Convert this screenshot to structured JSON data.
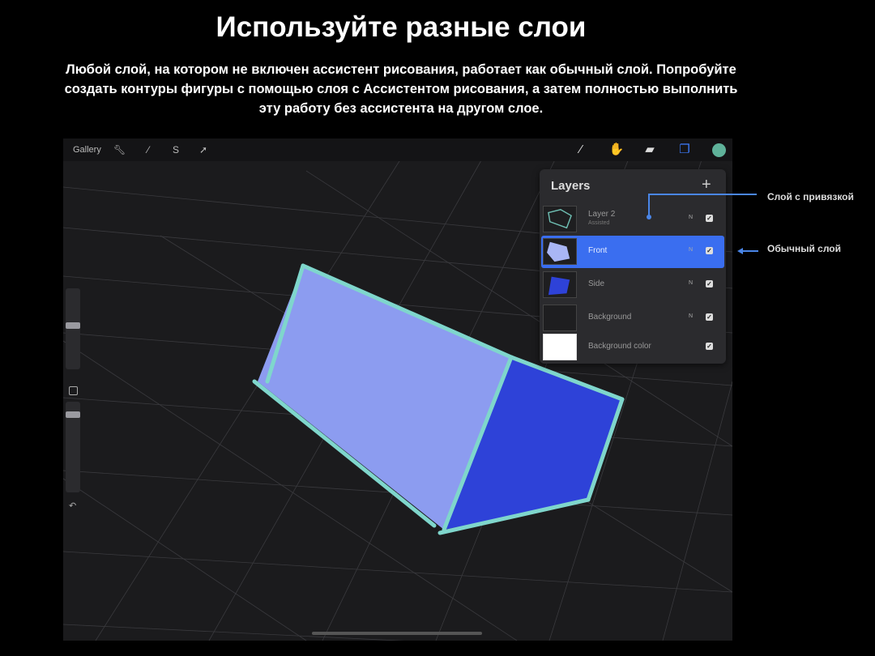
{
  "slide": {
    "title": "Используйте разные слои",
    "description_lines": [
      "Любой слой, на котором не включен ассистент рисования, работает как обычный слой. Попробуйте",
      "создать контуры фигуры с помощью слоя с Ассистентом рисования, а затем полностью выполнить",
      "эту работу без ассистента на другом слое."
    ]
  },
  "app": {
    "toolbar": {
      "gallery_label": "Gallery",
      "left_icons": [
        "wrench-icon",
        "magic-wand-icon",
        "selection-s-icon",
        "transform-arrow-icon"
      ],
      "right_icons": [
        "brush-icon",
        "smudge-icon",
        "eraser-icon",
        "layers-icon"
      ],
      "accent_color": "#3d7dff",
      "current_color": "#5fb29a"
    },
    "layers_panel": {
      "title": "Layers",
      "add_icon": "+",
      "layers": [
        {
          "name": "Layer 2",
          "sub": "Assisted",
          "mode": "N",
          "visible": true,
          "active": false,
          "thumb": "outline"
        },
        {
          "name": "Front",
          "sub": "",
          "mode": "N",
          "visible": true,
          "active": true,
          "thumb": "front"
        },
        {
          "name": "Side",
          "sub": "",
          "mode": "N",
          "visible": true,
          "active": false,
          "thumb": "side"
        },
        {
          "name": "Background",
          "sub": "",
          "mode": "N",
          "visible": true,
          "active": false,
          "thumb": "empty"
        },
        {
          "name": "Background color",
          "sub": "",
          "mode": "",
          "visible": true,
          "active": false,
          "thumb": "white"
        }
      ]
    },
    "check_glyph": "✓",
    "undo_glyph": "↶"
  },
  "callouts": {
    "assisted_layer": "Слой с привязкой",
    "normal_layer": "Обычный слой"
  },
  "colors": {
    "front_face": "#8c9cf0",
    "side_face": "#2e42d8",
    "outline": "#7fd6cc",
    "callout": "#4a86e8"
  }
}
